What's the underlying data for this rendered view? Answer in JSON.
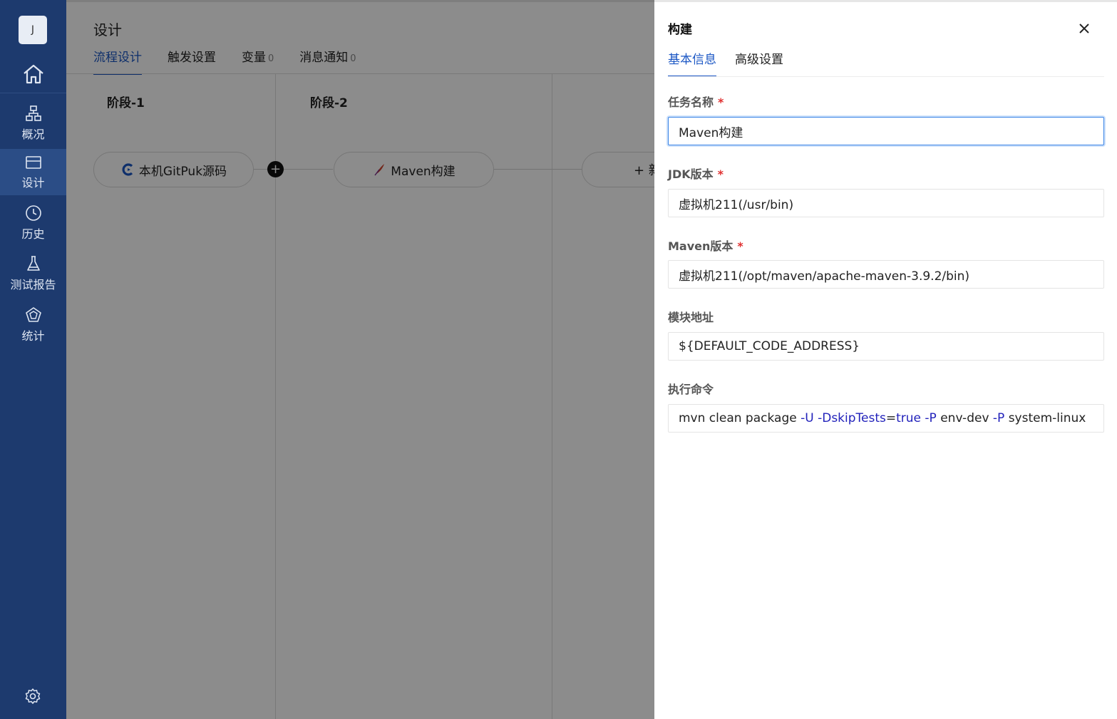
{
  "sidebar": {
    "avatar_letter": "J",
    "items": [
      {
        "label": "概况",
        "icon": "org-chart-icon"
      },
      {
        "label": "设计",
        "icon": "card-icon"
      },
      {
        "label": "历史",
        "icon": "clock-icon"
      },
      {
        "label": "测试报告",
        "icon": "flask-icon"
      },
      {
        "label": "统计",
        "icon": "pentagon-chart-icon"
      }
    ],
    "active_index": 1
  },
  "main": {
    "title": "设计",
    "tabs": [
      {
        "label": "流程设计",
        "count": ""
      },
      {
        "label": "触发设置",
        "count": ""
      },
      {
        "label": "变量",
        "count": "0"
      },
      {
        "label": "消息通知",
        "count": "0"
      }
    ],
    "stages": [
      {
        "title": "阶段-1",
        "task": "本机GitPuk源码"
      },
      {
        "title": "阶段-2",
        "task": "Maven构建"
      }
    ],
    "add_node_label": "+ 新"
  },
  "drawer": {
    "title": "构建",
    "tabs": [
      "基本信息",
      "高级设置"
    ],
    "fields": [
      {
        "label": "任务名称",
        "required": true,
        "value": "Maven构建"
      },
      {
        "label": "JDK版本",
        "required": true,
        "value": "虚拟机211(/usr/bin)"
      },
      {
        "label": "Maven版本",
        "required": true,
        "value": "虚拟机211(/opt/maven/apache-maven-3.9.2/bin)"
      },
      {
        "label": "模块地址",
        "required": false,
        "value": "${DEFAULT_CODE_ADDRESS}"
      },
      {
        "label": "执行命令",
        "required": false,
        "value": "mvn clean package -U -DskipTests=true -P env-dev -P system-linux"
      }
    ],
    "command_tokens": [
      {
        "t": "mvn clean package ",
        "kw": false
      },
      {
        "t": "-U -DskipTests",
        "kw": true
      },
      {
        "t": "=",
        "kw": false
      },
      {
        "t": "true -P",
        "kw": true
      },
      {
        "t": " env-dev ",
        "kw": false
      },
      {
        "t": "-P",
        "kw": true
      },
      {
        "t": " system-linux",
        "kw": false
      }
    ],
    "required_mark": "*"
  },
  "colors": {
    "sidebar_bg": "#1d3a6e",
    "accent": "#1a56c4",
    "required": "#e03030"
  }
}
